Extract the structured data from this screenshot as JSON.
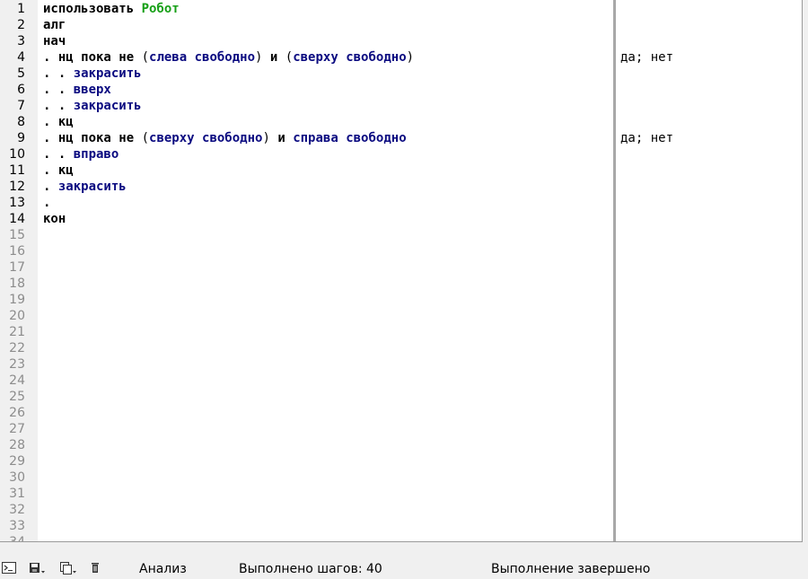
{
  "editor": {
    "lines": [
      {
        "n": "1",
        "tokens": [
          {
            "t": "использовать ",
            "c": "kw"
          },
          {
            "t": "Робот",
            "c": "mod"
          }
        ],
        "margin": ""
      },
      {
        "n": "2",
        "tokens": [
          {
            "t": "алг",
            "c": "kw"
          }
        ],
        "margin": ""
      },
      {
        "n": "3",
        "tokens": [
          {
            "t": "нач",
            "c": "kw"
          }
        ],
        "margin": ""
      },
      {
        "n": "4",
        "tokens": [
          {
            "t": ". нц пока не ",
            "c": "kw"
          },
          {
            "t": "(",
            "c": "par"
          },
          {
            "t": "слева свободно",
            "c": "act"
          },
          {
            "t": ")",
            "c": "par"
          },
          {
            "t": " и ",
            "c": "kw"
          },
          {
            "t": "(",
            "c": "par"
          },
          {
            "t": "сверху свободно",
            "c": "act"
          },
          {
            "t": ")",
            "c": "par"
          }
        ],
        "margin": "да; нет"
      },
      {
        "n": "5",
        "tokens": [
          {
            "t": ". . ",
            "c": "kw"
          },
          {
            "t": "закрасить",
            "c": "act"
          }
        ],
        "margin": ""
      },
      {
        "n": "6",
        "tokens": [
          {
            "t": ". . ",
            "c": "kw"
          },
          {
            "t": "вверх",
            "c": "act"
          }
        ],
        "margin": ""
      },
      {
        "n": "7",
        "tokens": [
          {
            "t": ". . ",
            "c": "kw"
          },
          {
            "t": "закрасить",
            "c": "act"
          }
        ],
        "margin": ""
      },
      {
        "n": "8",
        "tokens": [
          {
            "t": ". кц",
            "c": "kw"
          }
        ],
        "margin": ""
      },
      {
        "n": "9",
        "tokens": [
          {
            "t": ". нц пока не ",
            "c": "kw"
          },
          {
            "t": "(",
            "c": "par"
          },
          {
            "t": "сверху свободно",
            "c": "act"
          },
          {
            "t": ")",
            "c": "par"
          },
          {
            "t": " и ",
            "c": "kw"
          },
          {
            "t": "справа свободно",
            "c": "act"
          }
        ],
        "margin": "да; нет"
      },
      {
        "n": "10",
        "tokens": [
          {
            "t": ". . ",
            "c": "kw"
          },
          {
            "t": "вправо",
            "c": "act"
          }
        ],
        "margin": ""
      },
      {
        "n": "11",
        "tokens": [
          {
            "t": ". кц",
            "c": "kw"
          }
        ],
        "margin": ""
      },
      {
        "n": "12",
        "tokens": [
          {
            "t": ". ",
            "c": "kw"
          },
          {
            "t": "закрасить",
            "c": "act"
          }
        ],
        "margin": ""
      },
      {
        "n": "13",
        "tokens": [
          {
            "t": ".",
            "c": "kw"
          }
        ],
        "margin": ""
      },
      {
        "n": "14",
        "tokens": [
          {
            "t": "кон",
            "c": "kw"
          }
        ],
        "margin": ""
      }
    ],
    "empty_line_numbers": [
      "15",
      "16",
      "17",
      "18",
      "19",
      "20",
      "21",
      "22",
      "23",
      "24",
      "25",
      "26",
      "27",
      "28",
      "29",
      "30",
      "31",
      "32",
      "33",
      "34"
    ]
  },
  "statusbar": {
    "icons": [
      "terminal-icon",
      "save-icon",
      "copy-icon",
      "trash-icon"
    ],
    "mode_label": "Анализ",
    "steps_text": "Выполнено шагов: 40",
    "status_text": "Выполнение завершено"
  },
  "colors": {
    "keyword": "#000000",
    "action": "#0a0a80",
    "module": "#18a018",
    "gutter_bg": "#f0f0f0"
  }
}
